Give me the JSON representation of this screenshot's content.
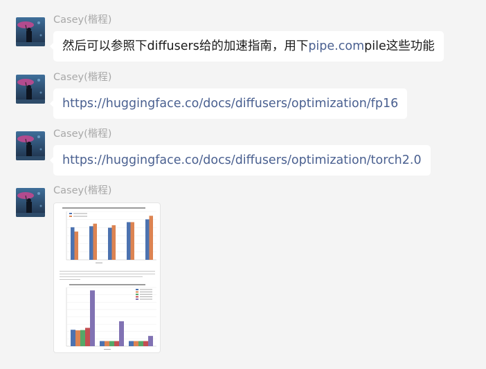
{
  "sender": "Casey(楷程)",
  "msg1": {
    "text_before": "然后可以参照下diffusers给的加速指南，用下",
    "link_text": "pipe.com",
    "text_after": "pile这些功能"
  },
  "msg2": {
    "link": "https://huggingface.co/docs/diffusers/optimization/fp16"
  },
  "msg3": {
    "link": "https://huggingface.co/docs/diffusers/optimization/torch2.0"
  },
  "colors": {
    "link": "#4a6090",
    "blue": "#4c72b0",
    "orange": "#dd8452",
    "green": "#55a868",
    "red": "#c44e52",
    "purple": "#8172b3"
  },
  "image_attachment": {
    "chart_data": [
      {
        "type": "bar",
        "title": "Diffusers speedup using torch.compile() (Text-to-Image, bs=4)",
        "categories": [
          "T4",
          "V100",
          "A100",
          "A100",
          "A100"
        ],
        "series": [
          {
            "name": "PyTorch 2 stable",
            "values": [
              1.28,
              1.32,
              1.26,
              1.48,
              1.59
            ]
          },
          {
            "name": "PyTorch 2 nightly",
            "values": [
              1.11,
              1.42,
              1.36,
              1.48,
              1.73
            ]
          }
        ],
        "ylim": [
          0,
          1.9
        ]
      },
      {
        "type": "bar",
        "title": "Diffusers Speedup on A100 using torch.compile in PyTorch 2.0 nightly",
        "categories": [
          "1",
          "4",
          "16"
        ],
        "series": [
          {
            "name": "Text-to-Image",
            "values": [
              112,
              35,
              35
            ]
          },
          {
            "name": "Image-to-Image",
            "values": [
              108,
              35,
              35
            ]
          },
          {
            "name": "Inpaint",
            "values": [
              110,
              35,
              35
            ]
          },
          {
            "name": "ControlNet",
            "values": [
              125,
              35,
              35
            ]
          },
          {
            "name": "IF Stage 1",
            "values": [
              380,
              170,
              70
            ]
          }
        ],
        "ylim": [
          0,
          400
        ]
      }
    ]
  }
}
